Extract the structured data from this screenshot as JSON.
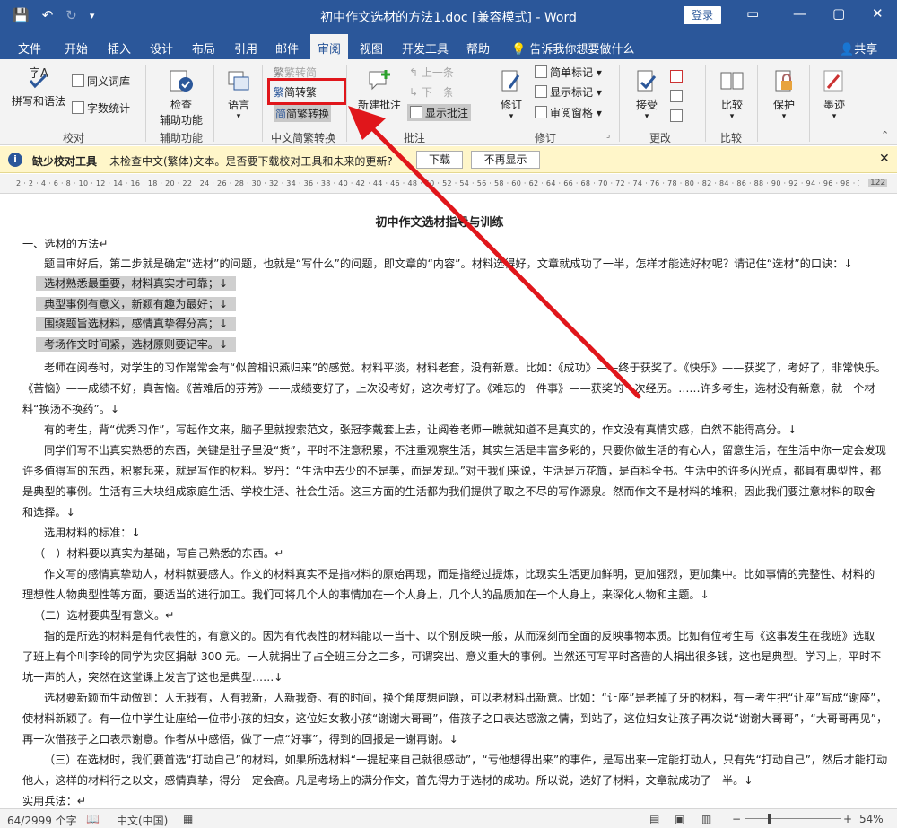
{
  "titlebar": {
    "title": "初中作文选材的方法1.doc [兼容模式] - Word",
    "login": "登录",
    "minimize": "—",
    "restore": "▢",
    "close": "✕"
  },
  "tabs": [
    "文件",
    "开始",
    "插入",
    "设计",
    "布局",
    "引用",
    "邮件",
    "审阅",
    "视图",
    "开发工具",
    "帮助"
  ],
  "tellme": "告诉我你想要做什么",
  "share": "共享",
  "ribbon": {
    "proofing": {
      "spelling": "拼写和语法",
      "thesaurus": "同义词库",
      "wordcount": "字数统计",
      "label": "校对"
    },
    "accessibility": {
      "check": "检查",
      "check2": "辅助功能",
      "label": "辅助功能"
    },
    "language": {
      "btn": "语言"
    },
    "chinese": {
      "t2s": "繁转简",
      "s2t": "简转繁",
      "convert": "简繁转换",
      "label": "中文简繁转换"
    },
    "comments": {
      "new": "新建批注",
      "prev": "上一条",
      "next": "下一条",
      "show": "显示批注",
      "label": "批注"
    },
    "tracking": {
      "track": "修订",
      "simple": "简单标记",
      "showmarkup": "显示标记",
      "pane": "审阅窗格",
      "label": "修订"
    },
    "changes": {
      "accept": "接受",
      "label": "更改"
    },
    "compare": {
      "btn": "比较",
      "label": "比较"
    },
    "protect": {
      "btn": "保护"
    },
    "ink": {
      "btn": "墨迹"
    }
  },
  "infobar": {
    "title": "缺少校对工具",
    "message": "未检查中文(繁体)文本。是否要下载校对工具和未来的更新?",
    "download": "下载",
    "dont_show": "不再显示"
  },
  "ruler": {
    "ticks": "2 · 2 · 4 · 6 · 8 · 10 · 12 · 14 · 16 · 18 · 20 · 22 · 24 · 26 · 28 · 30 · 32 · 34 · 36 · 38 · 40 · 42 · 44 · 46 · 48 · 50 · 52 · 54 · 56 · 58 · 60 · 62 · 64 · 66 · 68 · 70 · 72 · 74 · 76 · 78 · 80 · 82 · 84 · 86 · 88 · 90 · 92 · 94 · 96 · 98 · 100 · 102 · 104 · 106 · 108 · 110 · 112 · 114 · 116 · 118",
    "end": "122"
  },
  "document": {
    "title": "初中作文选材指导与训练",
    "lines": [
      "一、选材的方法↵",
      "题目审好后，第二步就是确定“选材”的问题，也就是“写什么”的问题，即文章的“内容”。材料选得好，文章就成功了一半，怎样才能选好材呢？请记住“选材”的口诀：↓",
      "选材熟悉最重要，材料真实才可靠；↓",
      "典型事例有意义，新颖有趣为最好；↓",
      "围绕题旨选材料，感情真挚得分高；↓",
      "考场作文时间紧，选材原则要记牢。↓",
      "老师在阅卷时，对学生的习作常常会有“似曾相识燕归来”的感觉。材料平淡，材料老套，没有新意。比如：《成功》——终于获奖了。《快乐》——获奖了，考好了，非常快乐。",
      "《苦恼》——成绩不好，真苦恼。《苦难后的芬芳》——成绩变好了，上次没考好，这次考好了。《难忘的一件事》——获奖的一次经历。……许多考生，选材没有新意，就一个材",
      "料“换汤不换药”。↓",
      "有的考生，背“优秀习作”，写起作文来，脑子里就搜索范文，张冠李戴套上去，让阅卷老师一瞧就知道不是真实的，作文没有真情实感，自然不能得高分。↓",
      "同学们写不出真实熟悉的东西，关键是肚子里没“货”，平时不注意积累，不注重观察生活，其实生活是丰富多彩的，只要你做生活的有心人，留意生活，在生活中你一定会发现",
      "许多值得写的东西，积累起来，就是写作的材料。罗丹：“生活中去少的不是美，而是发现。”对于我们来说，生活是万花筒，是百科全书。生活中的许多闪光点，都具有典型性，都",
      "是典型的事例。生活有三大块组成家庭生活、学校生活、社会生活。这三方面的生活都为我们提供了取之不尽的写作源泉。然而作文不是材料的堆积，因此我们要注意材料的取舍",
      "和选择。↓",
      "选用材料的标准：↓",
      "（一）材料要以真实为基础，写自己熟悉的东西。↵",
      "作文写的感情真挚动人，材料就要感人。作文的材料真实不是指材料的原始再现，而是指经过提炼，比现实生活更加鲜明，更加强烈，更加集中。比如事情的完整性、材料的",
      "理想性人物典型性等方面，要适当的进行加工。我们可将几个人的事情加在一个人身上，几个人的品质加在一个人身上，来深化人物和主题。↓",
      "（二）选材要典型有意义。↵",
      "指的是所选的材料是有代表性的，有意义的。因为有代表性的材料能以一当十、以个别反映一般，从而深刻而全面的反映事物本质。比如有位考生写《这事发生在我班》选取",
      "了班上有个叫李玲的同学为灾区捐献 300 元。一人就捐出了占全班三分之二多，可谓突出、意义重大的事例。当然还可写平时吝啬的人捐出很多钱，这也是典型。学习上，平时不",
      "坑一声的人，突然在这堂课上发言了这也是典型……↓",
      "选材要新颖而生动做到：人无我有，人有我新，人新我奇。有的时间，换个角度想问题，可以老材料出新意。比如：“让座”是老掉了牙的材料，有一考生把“让座”写成“谢座”，",
      "使材料新颖了。有一位中学生让座给一位带小孩的妇女，这位妇女教小孩“谢谢大哥哥”，借孩子之口表达感激之情，到站了，这位妇女让孩子再次说“谢谢大哥哥”，“大哥哥再见”，",
      "再一次借孩子之口表示谢意。作者从中感悟，做了一点“好事”，得到的回报是一谢再谢。↓",
      "（三）在选材时，我们要首选“打动自己”的材料，如果所选材料“一提起来自己就很感动”，“亏他想得出来”的事件，是写出来一定能打动人，只有先“打动自己”，然后才能打动",
      "他人，这样的材料行之以文，感情真挚，得分一定会高。凡是考场上的满分作文，首先得力于选材的成功。所以说，选好了材料，文章就成功了一半。↓",
      "实用兵法：↵"
    ]
  },
  "status": {
    "words": "64/2999 个字",
    "language": "中文(中国)",
    "zoom": "54%",
    "zoom_minus": "−",
    "zoom_plus": "+"
  },
  "colors": {
    "word_blue": "#2b579a",
    "ribbon_bg": "#f3f3f3",
    "infobar_bg": "#fff6c9",
    "annotation_red": "#e0161b"
  }
}
